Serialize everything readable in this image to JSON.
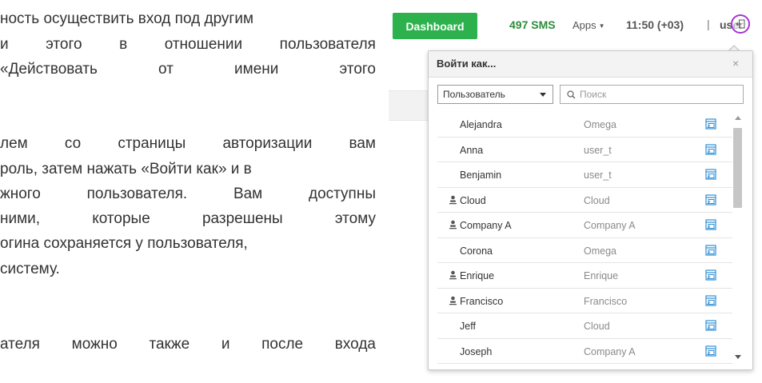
{
  "doc": {
    "lines": [
      {
        "text": "ность осуществить вход под другим",
        "justify": false
      },
      {
        "text": "и этого в отношении пользователя",
        "justify": true
      },
      {
        "text": "«Действовать от имени этого",
        "justify": true
      },
      {
        "text": "лем со страницы авторизации вам",
        "justify": true
      },
      {
        "text": "роль, затем нажать «Войти как» и в",
        "justify": false
      },
      {
        "text": "жного пользователя. Вам доступны",
        "justify": true
      },
      {
        "text": "ними, которые разрешены этому",
        "justify": true
      },
      {
        "text": "огина сохраняется у пользователя,",
        "justify": false
      },
      {
        "text": "систему.",
        "justify": false
      },
      {
        "text": "ателя можно также и после входа",
        "justify": true
      }
    ]
  },
  "topbar": {
    "dashboard_label": "Dashboard",
    "sms_label": "497 SMS",
    "apps_label": "Apps",
    "time_label": "11:50 (+03)",
    "separator": "|",
    "user_label": "user"
  },
  "popup": {
    "title": "Войти как...",
    "close_label": "×",
    "select_value": "Пользователь",
    "search_placeholder": "Поиск",
    "rows": [
      {
        "name": "Alejandra",
        "company": "Omega",
        "person_icon": false
      },
      {
        "name": "Anna",
        "company": "user_t",
        "person_icon": false
      },
      {
        "name": "Benjamin",
        "company": "user_t",
        "person_icon": false
      },
      {
        "name": "Cloud",
        "company": "Cloud",
        "person_icon": true
      },
      {
        "name": "Company A",
        "company": "Company A",
        "person_icon": true
      },
      {
        "name": "Corona",
        "company": "Omega",
        "person_icon": false
      },
      {
        "name": "Enrique",
        "company": "Enrique",
        "person_icon": true
      },
      {
        "name": "Francisco",
        "company": "Francisco",
        "person_icon": true
      },
      {
        "name": "Jeff",
        "company": "Cloud",
        "person_icon": false
      },
      {
        "name": "Joseph",
        "company": "Company A",
        "person_icon": false
      }
    ]
  },
  "colors": {
    "dashboard_green": "#2db14c",
    "sms_green": "#2e8c3a",
    "highlight_purple": "#a633d6",
    "action_icon_blue": "#2f8fd6"
  },
  "icons": {
    "logout": "logout-icon",
    "search": "search-icon",
    "person": "person-icon",
    "login_as_action": "login-as-icon",
    "close": "close-icon"
  }
}
